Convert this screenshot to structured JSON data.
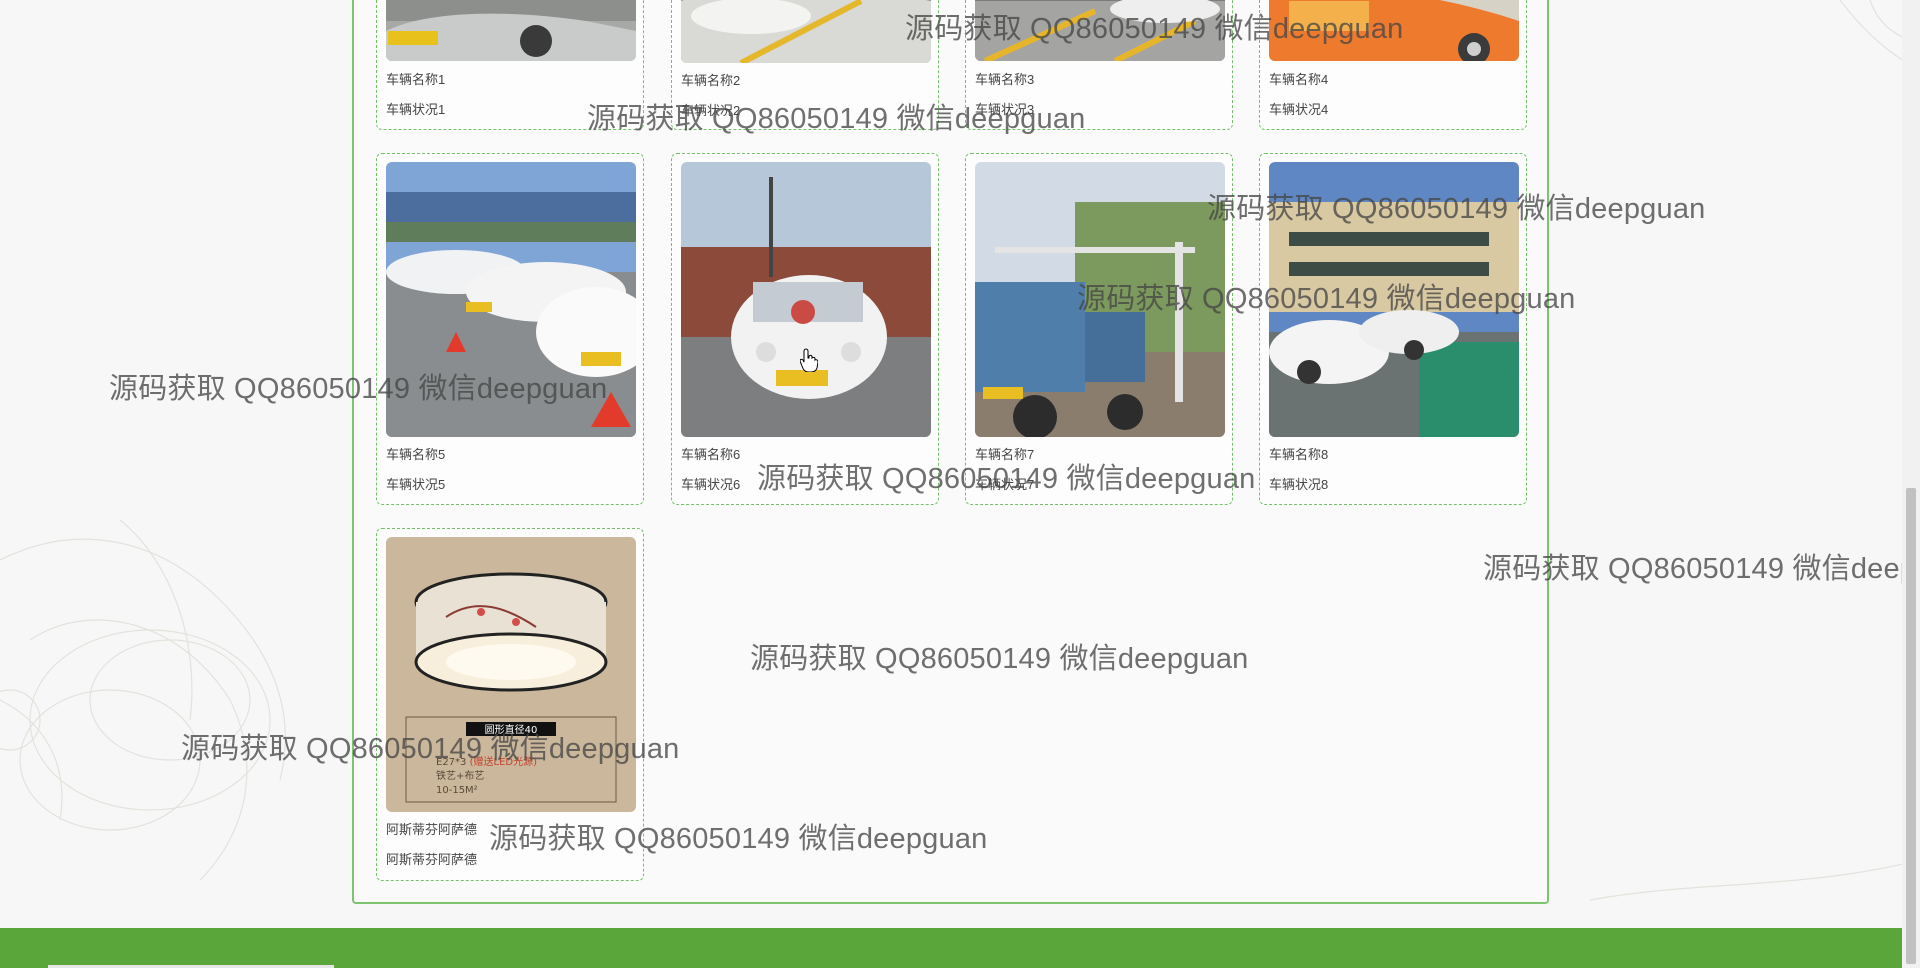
{
  "vehicles": [
    {
      "title": "车辆名称1",
      "status": "车辆状况1"
    },
    {
      "title": "车辆名称2",
      "status": "车辆状况2"
    },
    {
      "title": "车辆名称3",
      "status": "车辆状况3"
    },
    {
      "title": "车辆名称4",
      "status": "车辆状况4"
    },
    {
      "title": "车辆名称5",
      "status": "车辆状况5"
    },
    {
      "title": "车辆名称6",
      "status": "车辆状况6"
    },
    {
      "title": "车辆名称7",
      "status": "车辆状况7"
    },
    {
      "title": "车辆名称8",
      "status": "车辆状况8"
    },
    {
      "title": "阿斯蒂芬阿萨德",
      "status": "阿斯蒂芬阿萨德"
    }
  ],
  "lamp_label": "圆形直径40",
  "lamp_specs": {
    "line1": "E27*3",
    "line1_highlight": "(赠送LED光源)",
    "line2": "铁艺+布艺",
    "line3": "10-15M²"
  },
  "watermark": "源码获取 QQ86050149 微信deepguan",
  "colors": {
    "card_border": "#74c06a",
    "panel_border": "#7cc46f",
    "footer": "#5aa63a"
  }
}
